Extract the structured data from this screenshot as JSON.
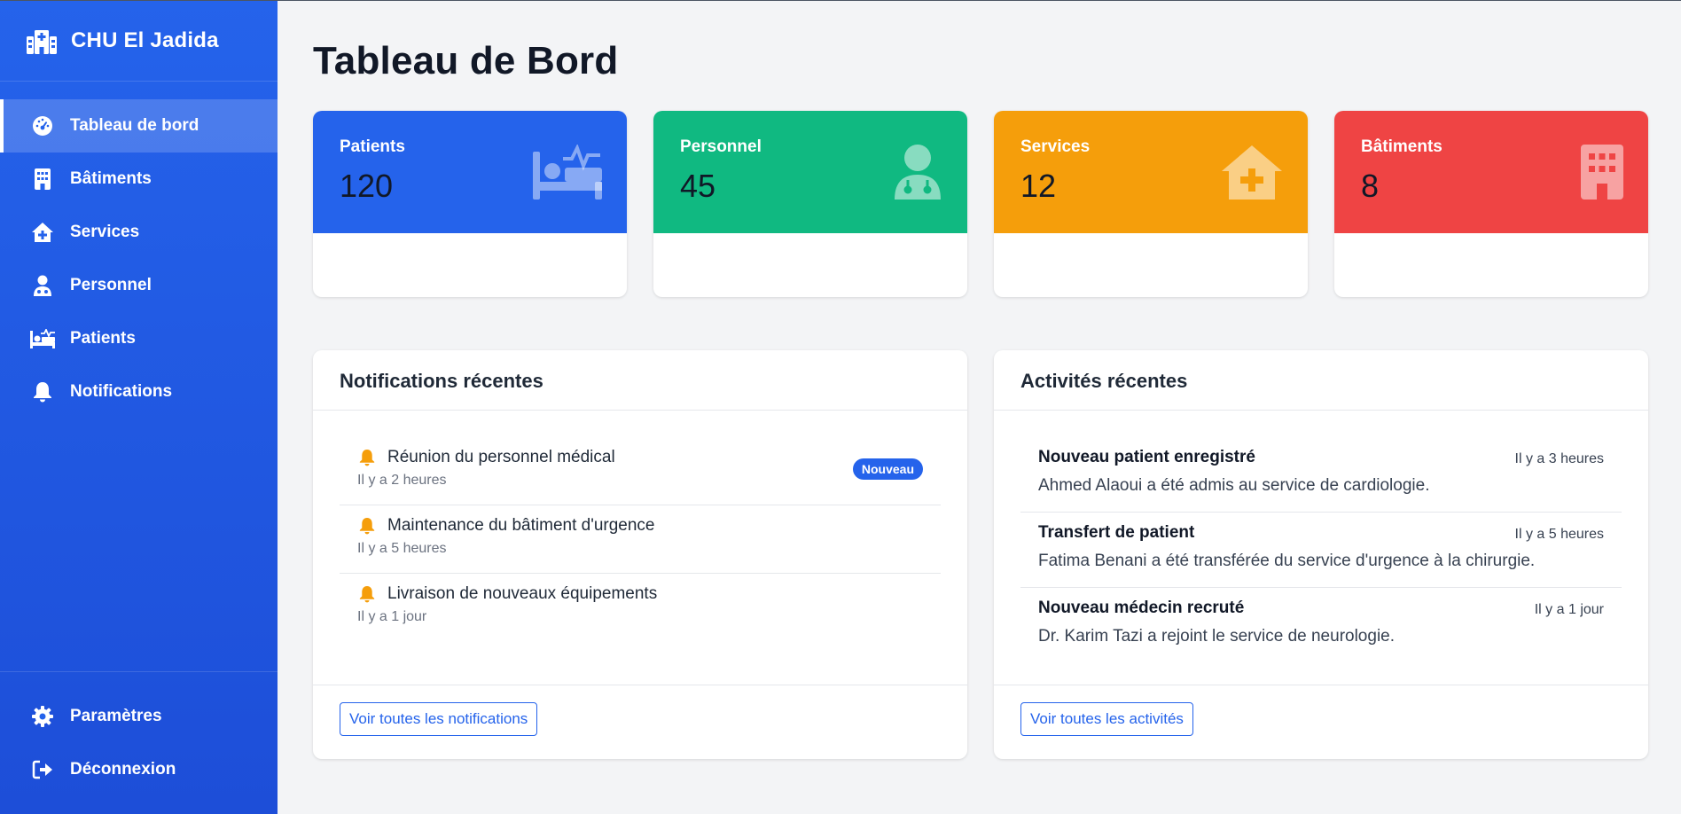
{
  "sidebar": {
    "brand": "CHU El Jadida",
    "items": [
      {
        "label": "Tableau de bord",
        "icon": "gauge-icon",
        "active": true
      },
      {
        "label": "Bâtiments",
        "icon": "building-icon"
      },
      {
        "label": "Services",
        "icon": "clinic-house-icon"
      },
      {
        "label": "Personnel",
        "icon": "doctor-icon"
      },
      {
        "label": "Patients",
        "icon": "hospital-bed-icon"
      },
      {
        "label": "Notifications",
        "icon": "bell-icon"
      }
    ],
    "bottom": [
      {
        "label": "Paramètres",
        "icon": "gear-icon"
      },
      {
        "label": "Déconnexion",
        "icon": "logout-icon"
      }
    ]
  },
  "page": {
    "title": "Tableau de Bord"
  },
  "stats": [
    {
      "label": "Patients",
      "value": "120",
      "icon": "hospital-bed-icon",
      "color": "#2563eb"
    },
    {
      "label": "Personnel",
      "value": "45",
      "icon": "doctor-icon",
      "color": "#10b981"
    },
    {
      "label": "Services",
      "value": "12",
      "icon": "clinic-house-icon",
      "color": "#f59e0b"
    },
    {
      "label": "Bâtiments",
      "value": "8",
      "icon": "building-icon",
      "color": "#ef4444"
    }
  ],
  "notifications": {
    "title": "Notifications récentes",
    "items": [
      {
        "title": "Réunion du personnel médical",
        "time": "Il y a 2 heures",
        "badge": "Nouveau"
      },
      {
        "title": "Maintenance du bâtiment d'urgence",
        "time": "Il y a 5 heures"
      },
      {
        "title": "Livraison de nouveaux équipements",
        "time": "Il y a 1 jour"
      }
    ],
    "button": "Voir toutes les notifications"
  },
  "activities": {
    "title": "Activités récentes",
    "items": [
      {
        "title": "Nouveau patient enregistré",
        "time": "Il y a 3 heures",
        "desc": "Ahmed Alaoui a été admis au service de cardiologie."
      },
      {
        "title": "Transfert de patient",
        "time": "Il y a 5 heures",
        "desc": "Fatima Benani a été transférée du service d'urgence à la chirurgie."
      },
      {
        "title": "Nouveau médecin recruté",
        "time": "Il y a 1 jour",
        "desc": "Dr. Karim Tazi a rejoint le service de neurologie."
      }
    ],
    "button": "Voir toutes les activités"
  },
  "colors": {
    "accent": "#2563eb",
    "bell": "#f59e0b"
  }
}
